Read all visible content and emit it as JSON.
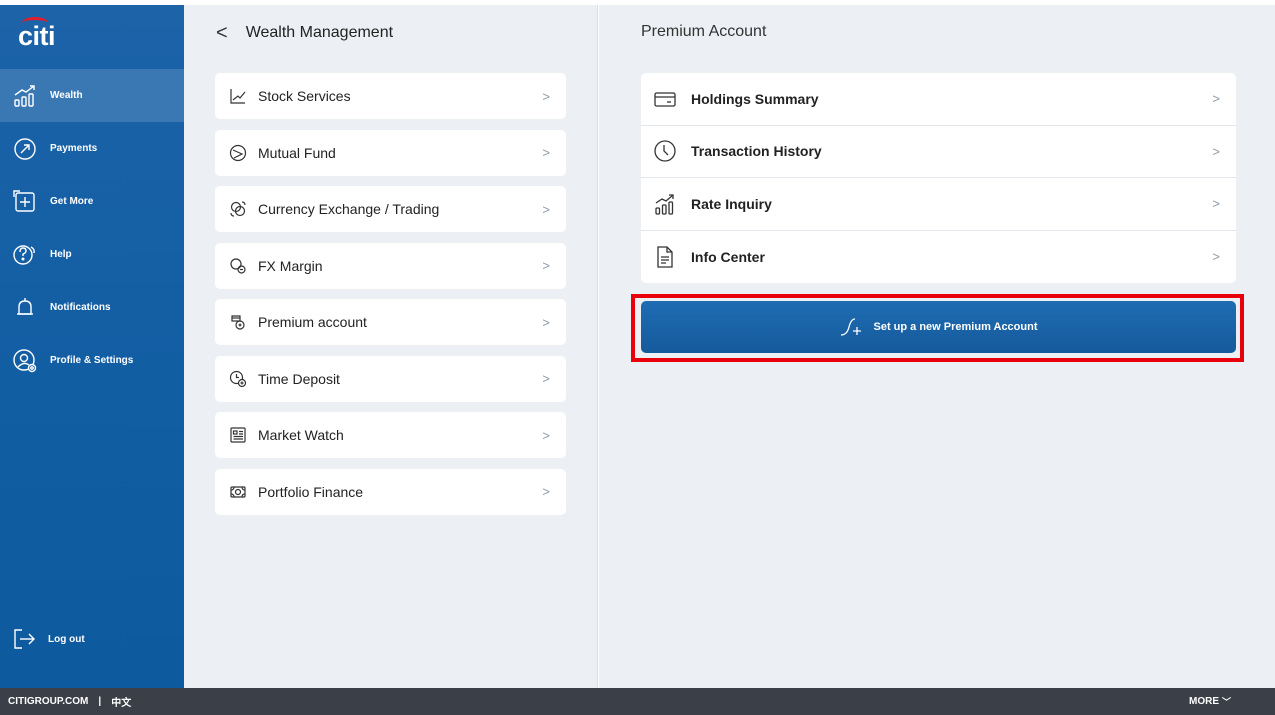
{
  "brand": {
    "logo_text": "citi"
  },
  "sidebar": {
    "items": [
      {
        "label": "Wealth",
        "icon": "wealth-chart-icon",
        "active": true
      },
      {
        "label": "Payments",
        "icon": "payments-arrow-icon"
      },
      {
        "label": "Get More",
        "icon": "get-more-plus-icon"
      },
      {
        "label": "Help",
        "icon": "help-question-icon"
      },
      {
        "label": "Notifications",
        "icon": "bell-icon"
      },
      {
        "label": "Profile & Settings",
        "icon": "profile-settings-icon"
      }
    ],
    "logout_label": "Log out"
  },
  "middle": {
    "title": "Wealth Management",
    "back_glyph": "<",
    "items": [
      {
        "label": "Stock Services",
        "icon": "stock-line-icon"
      },
      {
        "label": "Mutual Fund",
        "icon": "mutual-fund-icon"
      },
      {
        "label": "Currency Exchange / Trading",
        "icon": "currency-exchange-icon"
      },
      {
        "label": "FX Margin",
        "icon": "fx-margin-icon"
      },
      {
        "label": "Premium account",
        "icon": "premium-account-icon"
      },
      {
        "label": "Time Deposit",
        "icon": "time-deposit-icon"
      },
      {
        "label": "Market Watch",
        "icon": "market-watch-icon"
      },
      {
        "label": "Portfolio Finance",
        "icon": "portfolio-finance-icon"
      }
    ]
  },
  "right": {
    "title": "Premium Account",
    "items": [
      {
        "label": "Holdings Summary",
        "icon": "card-icon"
      },
      {
        "label": "Transaction History",
        "icon": "clock-icon"
      },
      {
        "label": "Rate Inquiry",
        "icon": "rate-chart-icon"
      },
      {
        "label": "Info Center",
        "icon": "document-icon"
      }
    ],
    "cta_label": "Set up a new Premium Account"
  },
  "footer": {
    "site": "CITIGROUP.COM",
    "separator": "|",
    "language": "中文",
    "more": "MORE",
    "more_glyph": "﹀"
  },
  "colors": {
    "sidebar": "#1c63a8",
    "panel_bg": "#eceff4",
    "footer": "#3b3f47",
    "highlight": "#e8000b",
    "cta": "#1a64aa"
  }
}
